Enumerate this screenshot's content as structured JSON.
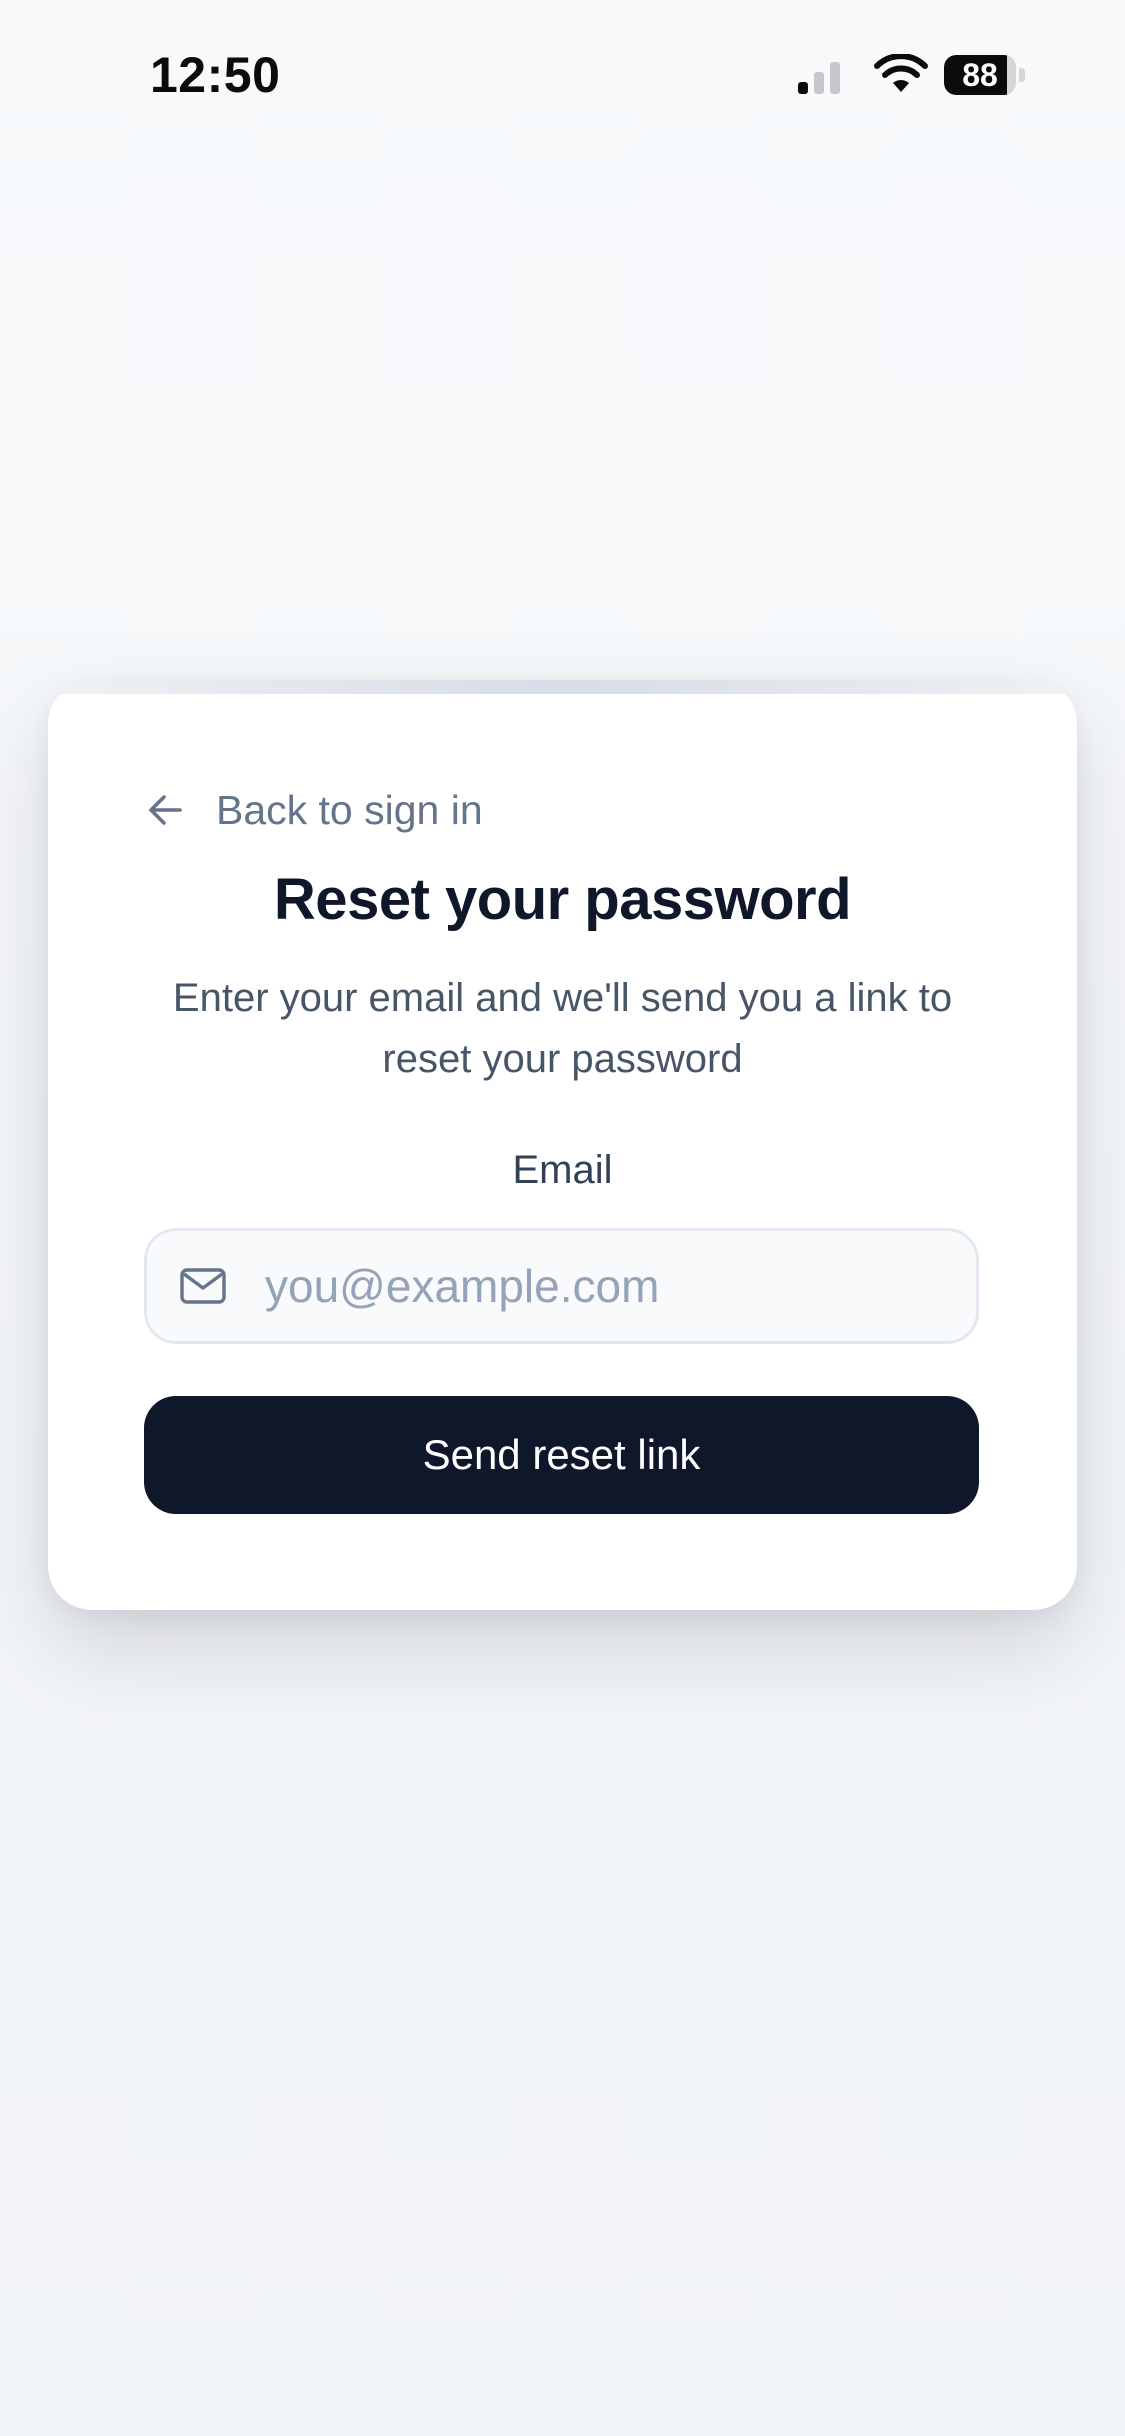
{
  "status_bar": {
    "time": "12:50",
    "battery_level": "88",
    "signal_bars_active": 1,
    "signal_bars_total": 3
  },
  "card": {
    "back_link_label": "Back to sign in",
    "title": "Reset your password",
    "subtitle": "Enter your email and we'll send you a link to reset your password",
    "email_label": "Email",
    "email_value": "",
    "email_placeholder": "you@example.com",
    "submit_label": "Send reset link"
  },
  "icons": {
    "back": "arrow-left-icon",
    "mail": "mail-icon",
    "wifi": "wifi-icon",
    "signal": "cellular-signal-icon",
    "battery": "battery-icon"
  },
  "colors": {
    "background": "#f4f6f9",
    "card": "#ffffff",
    "primary_button": "#0f172a",
    "title_text": "#0f172a",
    "muted_text": "#64748b",
    "placeholder": "#94a3b8",
    "input_border": "#e2e8f0"
  }
}
